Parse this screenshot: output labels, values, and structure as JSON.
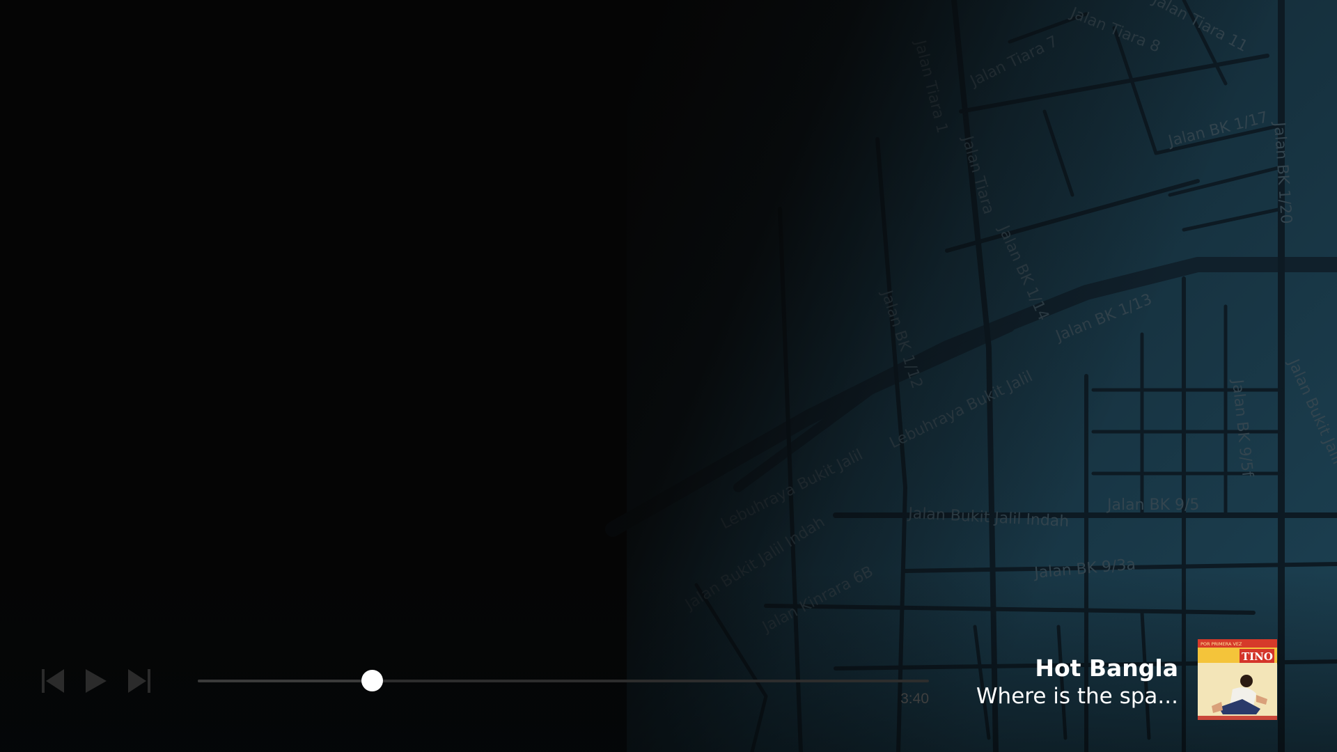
{
  "map": {
    "labels": [
      "Jalan Tiara 8",
      "Jalan Tiara 11",
      "Jalan Tiara 7",
      "Jalan Tiara 1",
      "Jalan Tiara",
      "Jalan BK 1/17",
      "Jalan BK 1/20",
      "Jalan BK 1/14",
      "Jalan BK 1/13",
      "Jalan BK 1/12",
      "Lebuhraya Bukit Jalil",
      "Lebuhraya Bukit Jalil",
      "Jalan Bukit Jalil",
      "Jalan BK 9/5f",
      "Jalan BK 9/5",
      "Jalan Bukit Jalil Indah",
      "Jalan Bukit Jalil Indah",
      "Jalan BK 9/3a",
      "Jalan Kinrara 6B"
    ]
  },
  "controls": {
    "previous_icon": "skip-previous-icon",
    "play_icon": "play-icon",
    "next_icon": "skip-next-icon"
  },
  "player": {
    "progress_fraction": 0.238,
    "duration": "3:40"
  },
  "track": {
    "title": "Hot Bangla",
    "subtitle": "Where is the spa...",
    "album_art": {
      "banner_text": "POR PRIMERA VEZ",
      "artist_text": "TINO"
    }
  },
  "colors": {
    "accent": "#ffffff",
    "map_bg": "#1b3a4a"
  }
}
